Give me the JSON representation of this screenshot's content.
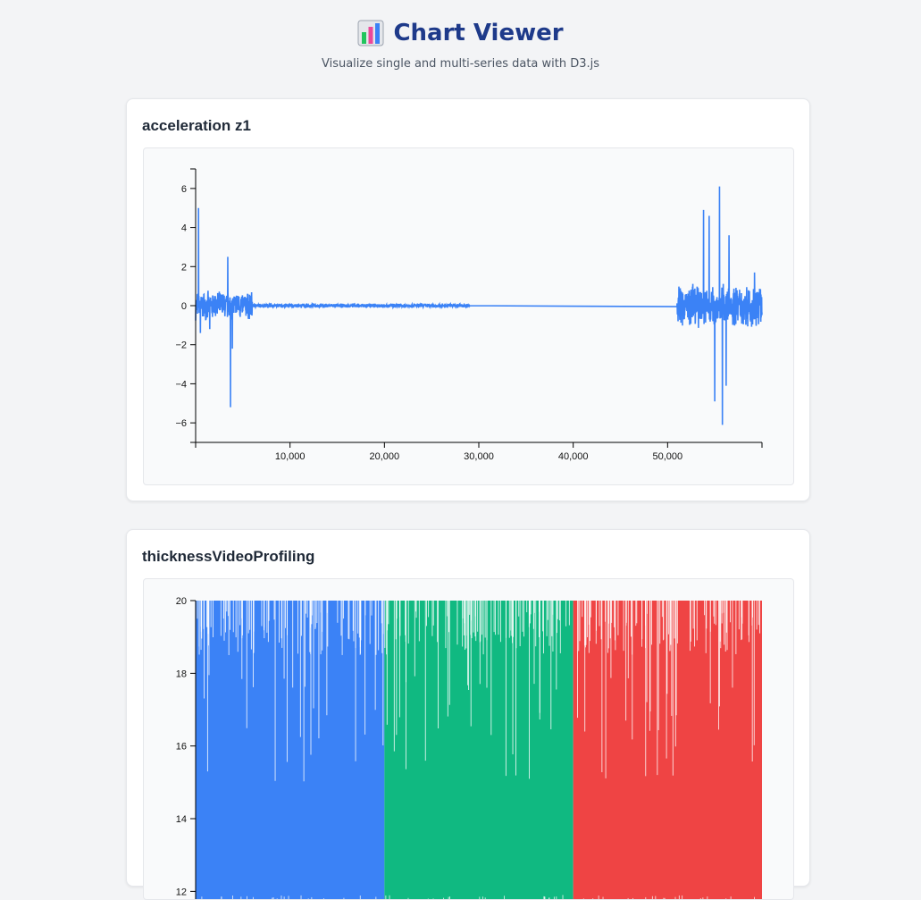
{
  "header": {
    "title": "Chart Viewer",
    "subtitle": "Visualize single and multi-series data with D3.js",
    "logo_icon": "bar-chart-icon"
  },
  "chart_data": [
    {
      "type": "line",
      "title": "acceleration z1",
      "xlabel": "",
      "ylabel": "",
      "xlim": [
        0,
        60000
      ],
      "ylim": [
        -7,
        7
      ],
      "xticks": [
        10000,
        20000,
        30000,
        40000,
        50000
      ],
      "xtick_labels": [
        "10,000",
        "20,000",
        "30,000",
        "40,000",
        "50,000"
      ],
      "yticks": [
        -6,
        -4,
        -2,
        0,
        2,
        4,
        6
      ],
      "ytick_labels": [
        "−6",
        "−4",
        "−2",
        "0",
        "2",
        "4",
        "6"
      ],
      "grid": false,
      "color": "#3b82f6",
      "segments": [
        {
          "x_start": 0,
          "x_end": 6000,
          "amplitude": 0.8,
          "spikes": [
            [
              300,
              5.0
            ],
            [
              500,
              -1.4
            ],
            [
              1500,
              -1.2
            ],
            [
              3400,
              2.5
            ],
            [
              3700,
              -5.2
            ],
            [
              3900,
              -2.2
            ]
          ]
        },
        {
          "x_start": 6000,
          "x_end": 29000,
          "amplitude": 0.12,
          "spikes": []
        },
        {
          "x_start": 29000,
          "x_end": 51000,
          "amplitude": 0.0,
          "spikes": []
        },
        {
          "x_start": 51000,
          "x_end": 60000,
          "amplitude": 1.2,
          "spikes": [
            [
              53800,
              4.9
            ],
            [
              54400,
              4.6
            ],
            [
              55000,
              -4.9
            ],
            [
              55500,
              6.1
            ],
            [
              55800,
              -6.1
            ],
            [
              56200,
              -4.1
            ],
            [
              56500,
              3.6
            ],
            [
              59200,
              1.7
            ]
          ]
        }
      ]
    },
    {
      "type": "line",
      "title": "thicknessVideoProfiling",
      "xlabel": "",
      "ylabel": "",
      "ylim": [
        11,
        20
      ],
      "yticks": [
        12,
        14,
        16,
        18,
        20
      ],
      "ytick_labels": [
        "12",
        "14",
        "16",
        "18",
        "20"
      ],
      "grid": false,
      "series": [
        {
          "color": "#3b82f6",
          "x_range": [
            0,
            1
          ],
          "top": 20
        },
        {
          "color": "#10b981",
          "x_range": [
            1,
            2
          ],
          "top": 20
        },
        {
          "color": "#ef4444",
          "x_range": [
            2,
            3
          ],
          "top": 20
        }
      ]
    }
  ]
}
